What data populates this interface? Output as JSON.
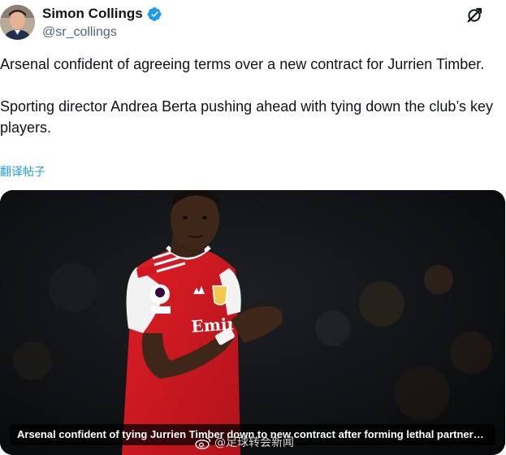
{
  "author": {
    "name": "Simon Collings",
    "handle": "@sr_collings",
    "verified_color": "#1d9bf0"
  },
  "header": {
    "grok_icon": "grok-icon"
  },
  "tweet": {
    "paragraphs": [
      "Arsenal confident of agreeing terms over a new contract for Jurrien Timber.",
      "Sporting director Andrea Berta pushing ahead with tying down the club’s key players."
    ],
    "translate_label": "翻译帖子"
  },
  "media": {
    "caption": "Arsenal confident of tying Jurrien Timber down to new contract after forming lethal partnership",
    "shirt_sponsor": "Emira",
    "watermark": "@足球转会新闻",
    "colors": {
      "shirt_red": "#d2161f",
      "sleeve_white": "#f2f2f2",
      "background": "#0c0e10"
    }
  }
}
